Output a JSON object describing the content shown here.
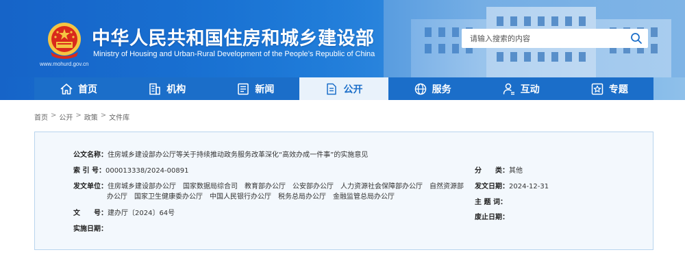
{
  "header": {
    "cn_title": "中华人民共和国住房和城乡建设部",
    "en_title": "Ministry of Housing and Urban-Rural Development of the People’s Republic of China",
    "site_url": "www.mohurd.gov.cn",
    "search_placeholder": "请输入搜索的内容",
    "colors": {
      "banner": "#1a76d6",
      "nav": "#1b6ec9",
      "nav_active_bg": "#e9f2fb"
    }
  },
  "nav": {
    "items": [
      {
        "label": "首页",
        "icon": "home-icon"
      },
      {
        "label": "机构",
        "icon": "building-icon"
      },
      {
        "label": "新闻",
        "icon": "news-icon"
      },
      {
        "label": "公开",
        "icon": "document-icon",
        "active": true
      },
      {
        "label": "服务",
        "icon": "globe-icon"
      },
      {
        "label": "互动",
        "icon": "user-interaction-icon"
      },
      {
        "label": "专题",
        "icon": "star-icon"
      }
    ]
  },
  "breadcrumb": {
    "items": [
      "首页",
      "公开",
      "政策",
      "文件库"
    ],
    "separator": ">"
  },
  "doc": {
    "title_label": "公文名称：",
    "title_value": "住房城乡建设部办公厅等关于持续推动政务服务改革深化“高效办成一件事”的实施意见",
    "index_label": "索 引 号：",
    "index_value": "000013338/2024-00891",
    "category_label": "分　　类：",
    "category_value": "其他",
    "issuer_label": "发文单位：",
    "issuer_line1": "住房城乡建设部办公厅　国家数据局综合司　教育部办公厅　公安部办公厅　人力资源社会保障部办公厅　自然资源部",
    "issuer_line2": "办公厅　国家卫生健康委办公厅　中国人民银行办公厅　税务总局办公厅　金融监管总局办公厅",
    "date_label": "发文日期：",
    "date_value": "2024-12-31",
    "keywords_label": "主 题 词：",
    "keywords_value": "",
    "number_label": "文　　号：",
    "number_value": "建办厅〔2024〕64号",
    "effective_label": "实施日期：",
    "effective_value": "",
    "repeal_label": "废止日期：",
    "repeal_value": ""
  }
}
